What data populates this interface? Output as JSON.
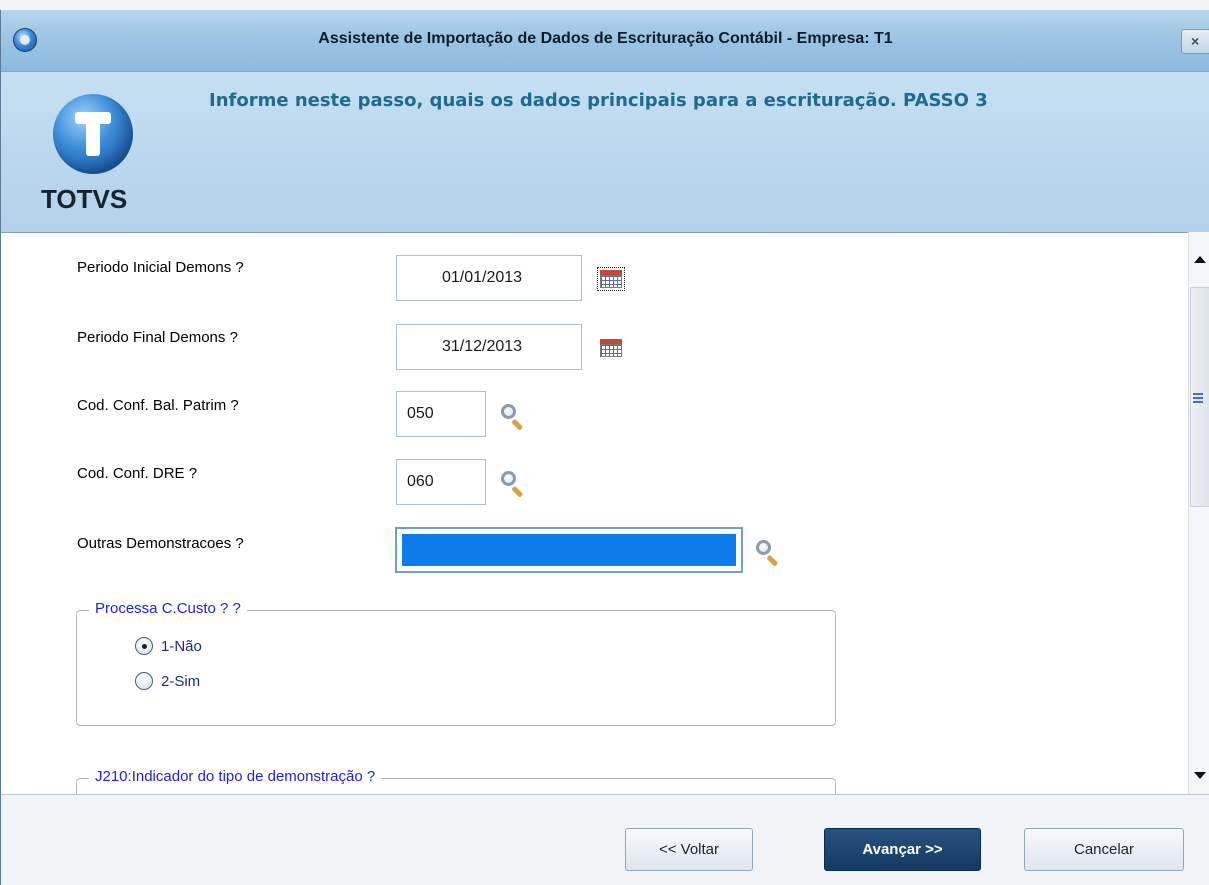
{
  "window": {
    "title": "Assistente de Importação de Dados de Escrituração Contábil - Empresa: T1",
    "close_label": "×"
  },
  "header": {
    "brand": "TOTVS",
    "instruction": "Informe neste passo, quais os dados principais para a escrituração. PASSO 3"
  },
  "form": {
    "periodo_inicial": {
      "label": "Periodo Inicial Demons ?",
      "value": "01/01/2013"
    },
    "periodo_final": {
      "label": "Periodo Final Demons ?",
      "value": "31/12/2013"
    },
    "cod_bal_patrim": {
      "label": "Cod. Conf. Bal. Patrim ?",
      "value": "050"
    },
    "cod_dre": {
      "label": "Cod. Conf. DRE ?",
      "value": "060"
    },
    "outras_demonstracoes": {
      "label": "Outras Demonstracoes ?",
      "value": ""
    }
  },
  "groups": {
    "processa_ccusto": {
      "legend": "Processa C.Custo ? ?",
      "options": [
        {
          "label": "1-Não",
          "checked": true
        },
        {
          "label": "2-Sim",
          "checked": false
        }
      ]
    },
    "j210": {
      "legend": "J210:Indicador do tipo de demonstração ?"
    }
  },
  "buttons": {
    "back": "<< Voltar",
    "next": "Avançar >>",
    "cancel": "Cancelar"
  },
  "icons": {
    "calendar": "calendar-icon",
    "lookup": "magnifier-icon"
  },
  "colors": {
    "title_gradient": "#9cc5e3",
    "instruction_text": "#1d6b8e",
    "legend_text": "#2222dd",
    "selection": "#0d7bea",
    "primary_button": "#1b4472"
  }
}
